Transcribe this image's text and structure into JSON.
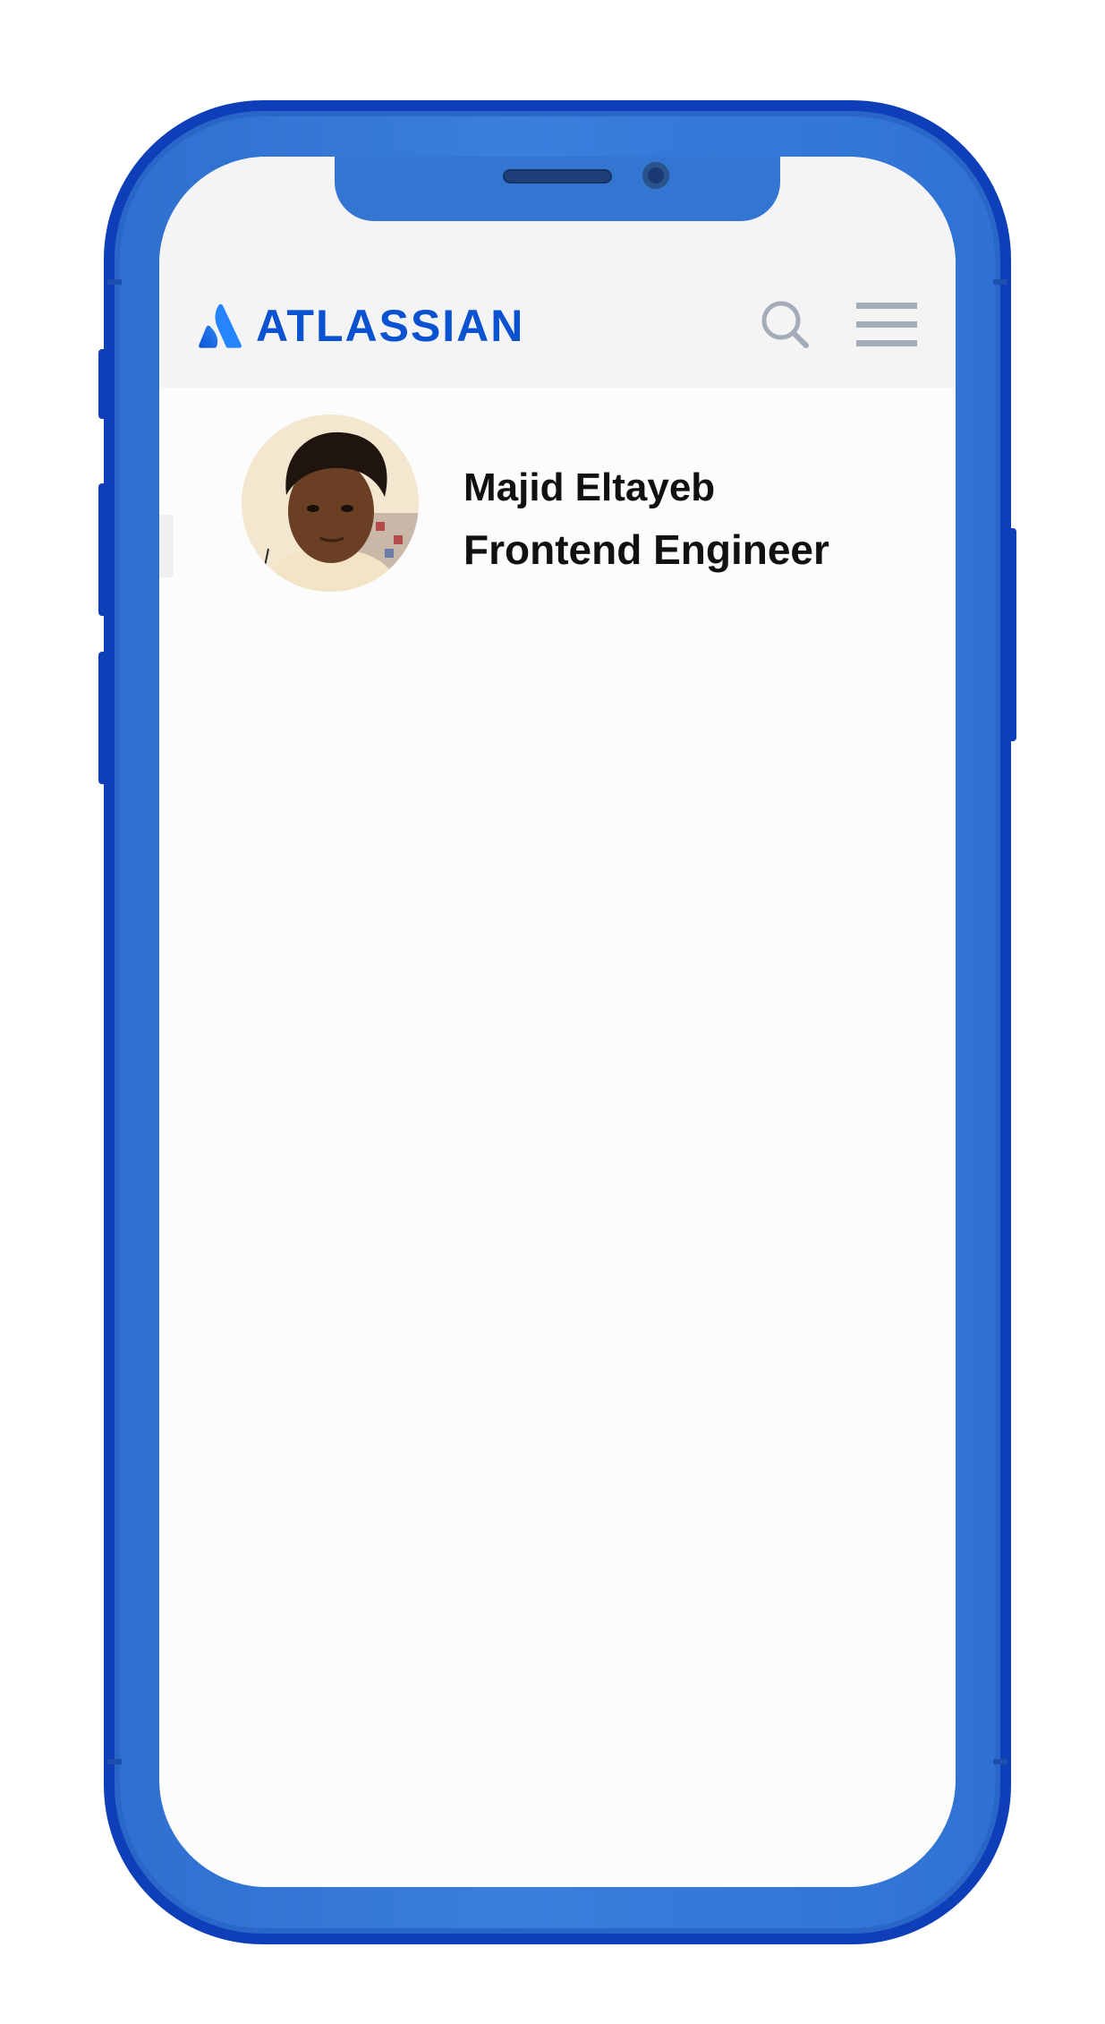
{
  "header": {
    "logo_text": "ATLASSIAN",
    "icons": [
      "search-icon",
      "hamburger-menu-icon"
    ]
  },
  "profile": {
    "name": "Majid Eltayeb",
    "title": "Frontend Engineer"
  },
  "colors": {
    "brand_blue": "#0b52d0",
    "device_frame": "#2f6fcf",
    "header_bg": "#f4f4f5",
    "icon_gray": "#a4acba"
  }
}
